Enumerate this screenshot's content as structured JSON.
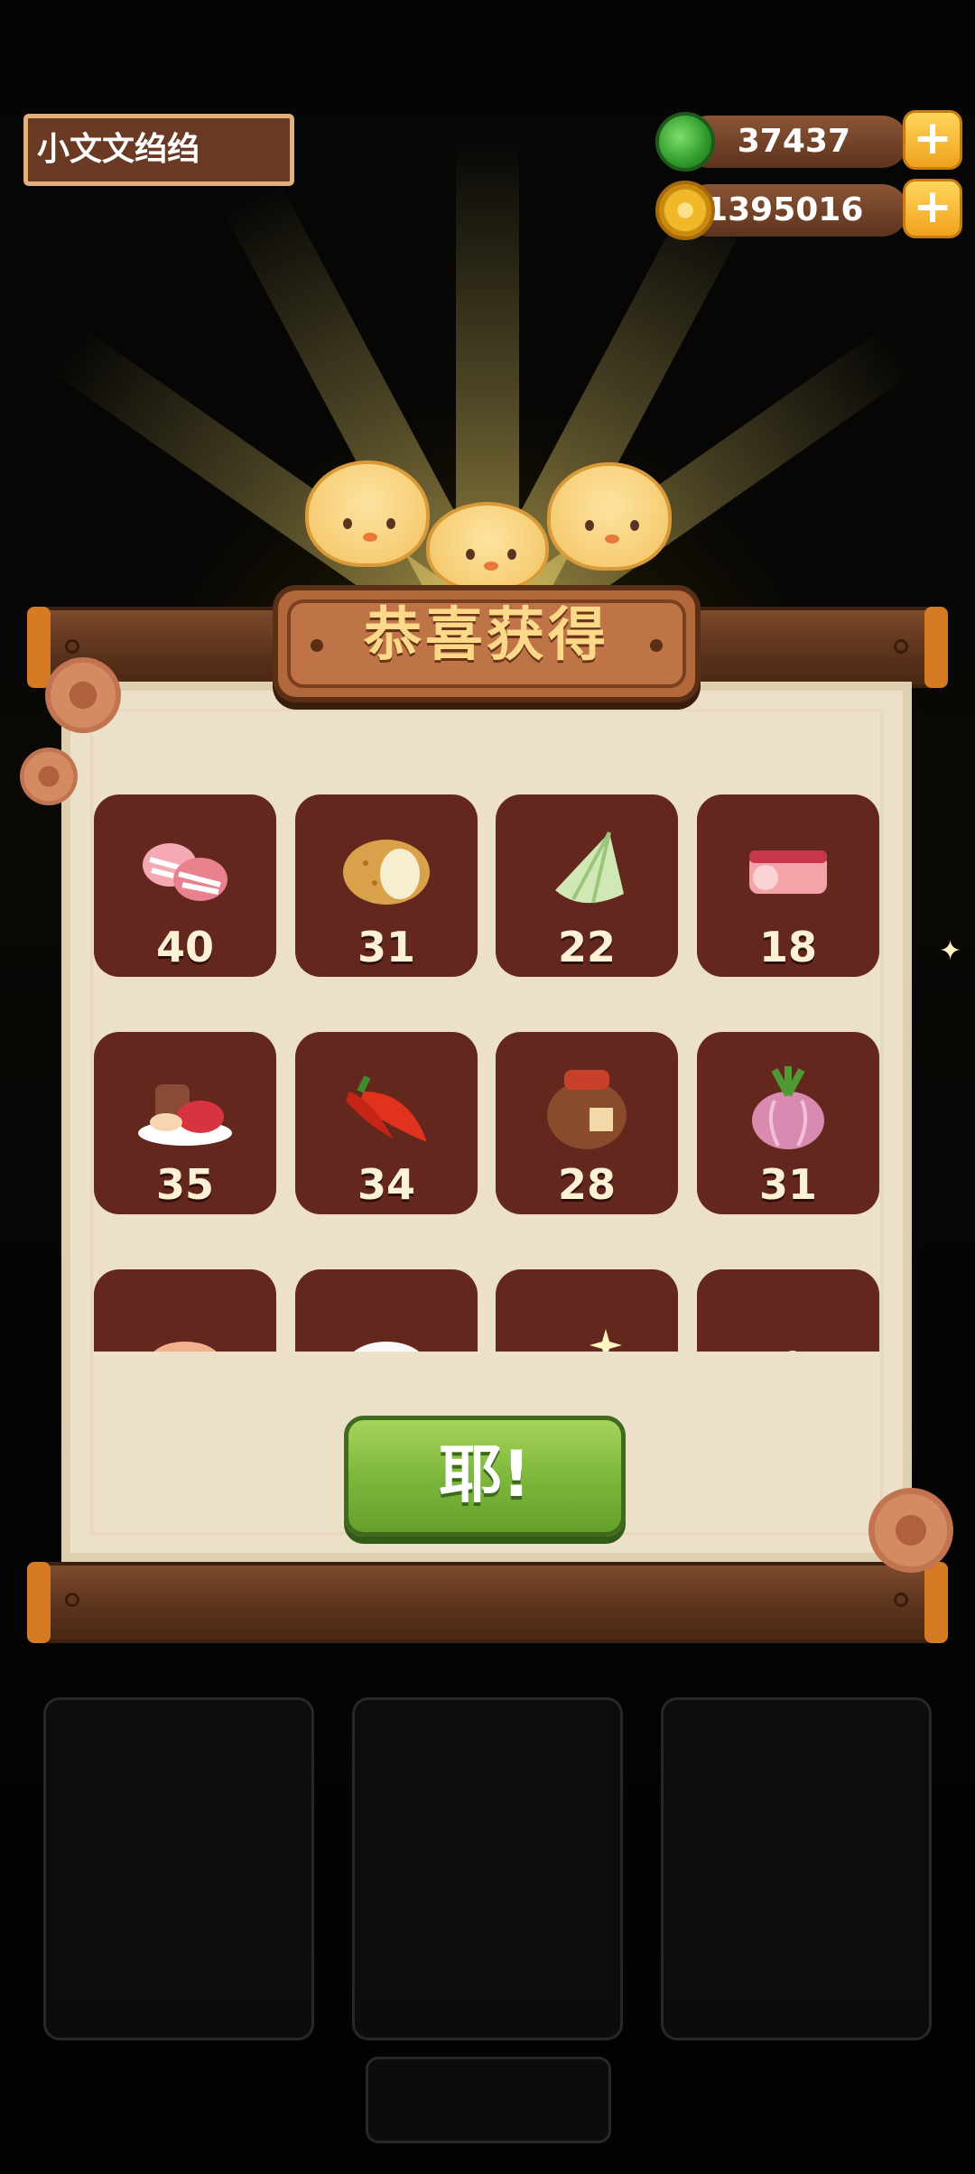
{
  "player": {
    "name": "小文文绉绉"
  },
  "currencies": [
    {
      "name": "jade",
      "amount": "37437",
      "icon": "jade-icon",
      "color": "#3fb43a"
    },
    {
      "name": "coin",
      "amount": "11395016",
      "icon": "coin-icon",
      "color": "#f1b92a"
    }
  ],
  "reward_dialog": {
    "title": "恭喜获得",
    "confirm_label": "耶!",
    "items": [
      {
        "icon": "bacon-icon",
        "count": "40"
      },
      {
        "icon": "potato-icon",
        "count": "31"
      },
      {
        "icon": "bamboo-shoot-icon",
        "count": "22"
      },
      {
        "icon": "pork-belly-icon",
        "count": "18"
      },
      {
        "icon": "meat-platter-icon",
        "count": "35"
      },
      {
        "icon": "chili-pepper-icon",
        "count": "34"
      },
      {
        "icon": "wine-jar-icon",
        "count": "28"
      },
      {
        "icon": "onion-icon",
        "count": "31"
      },
      {
        "icon": "chicken-wing-icon",
        "count": ""
      },
      {
        "icon": "rice-icon",
        "count": ""
      },
      {
        "icon": "sparkling-steak-icon",
        "count": ""
      },
      {
        "icon": "vegetable-dish-icon",
        "count": ""
      }
    ]
  },
  "colors": {
    "accent": "#f0a21e",
    "tile": "#64271d",
    "button": "#7bb53a",
    "title_text": "#ffd98a"
  }
}
